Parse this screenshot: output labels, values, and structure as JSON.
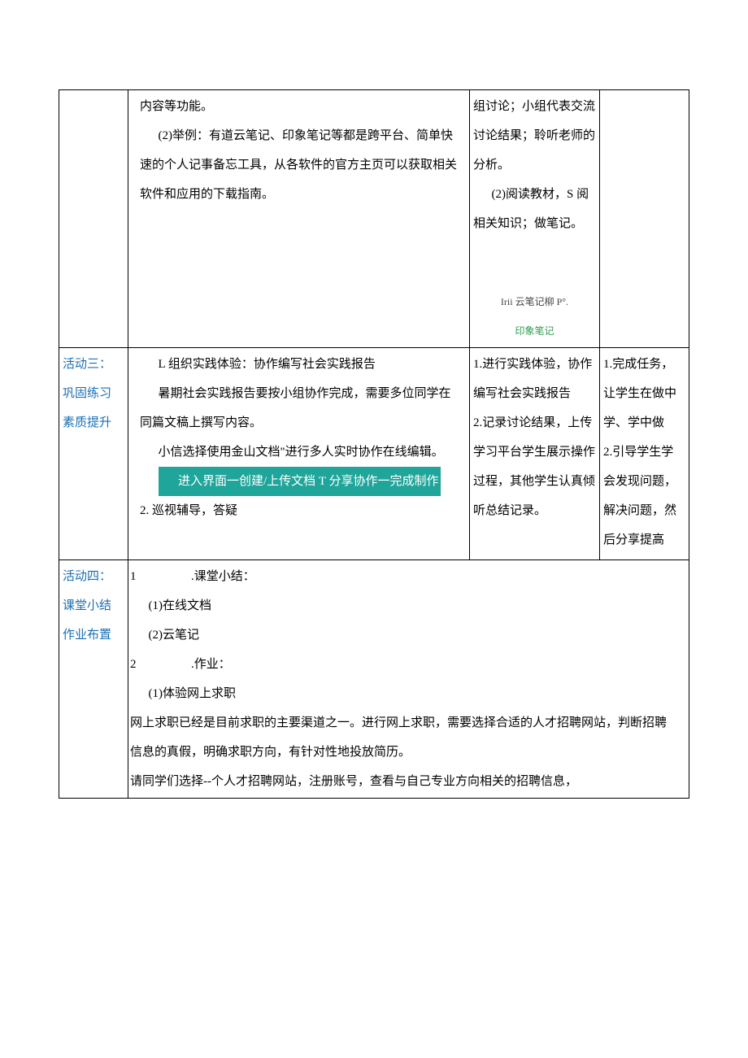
{
  "row1": {
    "col2": {
      "p1": "内容等功能。",
      "p2": "(2)举例：有道云笔记、印象笔记等都是跨平台、简单快速的个人记事备忘工具，从各软件的官方主页可以获取相关软件和应用的下载指南。"
    },
    "col3": {
      "p1": "组讨论；小组代表交流讨论结果；聆听老师的分析。",
      "p2": "(2)阅读教材，S 阅相关知识；做笔记。",
      "small1": "Irii 云笔记柳 P°.",
      "small2": "印象笔记"
    }
  },
  "row2": {
    "col1": {
      "l1": "活动三：",
      "l2": "巩固练习",
      "l3": "素质提升"
    },
    "col2": {
      "p1": "L 组织实践体验：协作编写社会实践报告",
      "p2": "暑期社会实践报告要按小组协作完成，需要多位同学在同篇文稿上撰写内容。",
      "p3": "小信选择使用金山文档\"进行多人实时协作在线编辑。",
      "hl": "进入界面一创建/上传文档 T 分享协作一完成制作",
      "p4": "2. 巡视辅导，答疑"
    },
    "col3": {
      "p1": "1.进行实践体验，协作编写社会实践报告",
      "p2": "2.记录讨论结果，上传学习平台学生展示操作过程，其他学生认真倾听总结记录。"
    },
    "col4": {
      "p1": "1.完成任务，让学生在做中学、学中做",
      "p2": "2.引导学生学会发现问题，解决问题，然后分享提高"
    }
  },
  "row3": {
    "col1": {
      "l1": "活动四：",
      "l2": "课堂小结",
      "l3": "作业布置"
    },
    "col2": {
      "p1_left": "1",
      "p1_right": ".课堂小结：",
      "p2": "(1)在线文档",
      "p3": "(2)云笔记",
      "p4_left": "2",
      "p4_right": ".作业：",
      "p5": "(1)体验网上求职",
      "p6": "网上求职已经是目前求职的主要渠道之一。进行网上求职，需要选择合适的人才招聘网站，判断招聘信息的真假，明确求职方向，有针对性地投放简历。",
      "p7": "请同学们选择--个人才招聘网站，注册账号，查看与自己专业方向相关的招聘信息，"
    }
  }
}
